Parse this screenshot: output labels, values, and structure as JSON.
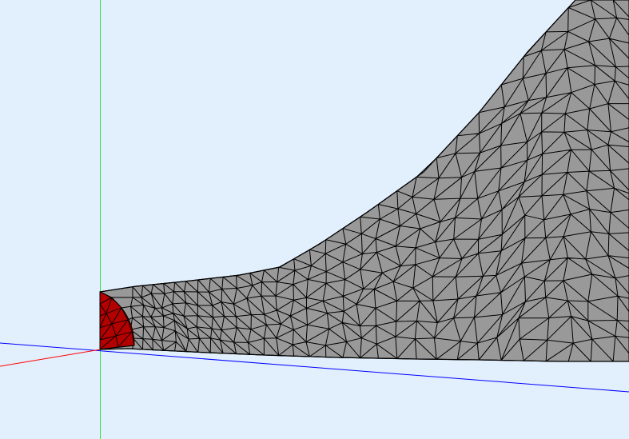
{
  "viewport": {
    "background_color": "#e2f0fd"
  },
  "axes": {
    "x_axis_color": "#0000ff",
    "y_axis_color": "#33dd44",
    "z_axis_color": "#ff0000"
  },
  "mesh": {
    "surface_fill": "#999999",
    "edge_color": "#000000",
    "selected_face_fill": "#b30000",
    "element_type": "triangle"
  }
}
